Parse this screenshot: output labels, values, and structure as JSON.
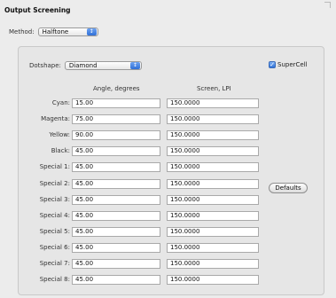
{
  "title": "Output Screening",
  "method": {
    "label": "Method:",
    "value": "Halftone"
  },
  "dotshape": {
    "label": "Dotshape:",
    "value": "Diamond"
  },
  "supercell": {
    "label": "SuperCell",
    "checked": true
  },
  "columns": {
    "angle": "Angle, degrees",
    "screen": "Screen, LPI"
  },
  "defaults_button": "Defaults",
  "rows": [
    {
      "label": "Cyan:",
      "angle": "15.00",
      "screen": "150.0000"
    },
    {
      "label": "Magenta:",
      "angle": "75.00",
      "screen": "150.0000"
    },
    {
      "label": "Yellow:",
      "angle": "90.00",
      "screen": "150.0000"
    },
    {
      "label": "Black:",
      "angle": "45.00",
      "screen": "150.0000"
    },
    {
      "label": "Special 1:",
      "angle": "45.00",
      "screen": "150.0000"
    },
    {
      "label": "Special 2:",
      "angle": "45.00",
      "screen": "150.0000"
    },
    {
      "label": "Special 3:",
      "angle": "45.00",
      "screen": "150.0000"
    },
    {
      "label": "Special 4:",
      "angle": "45.00",
      "screen": "150.0000"
    },
    {
      "label": "Special 5:",
      "angle": "45.00",
      "screen": "150.0000"
    },
    {
      "label": "Special 6:",
      "angle": "45.00",
      "screen": "150.0000"
    },
    {
      "label": "Special 7:",
      "angle": "45.00",
      "screen": "150.0000"
    },
    {
      "label": "Special 8:",
      "angle": "45.00",
      "screen": "150.0000"
    }
  ]
}
